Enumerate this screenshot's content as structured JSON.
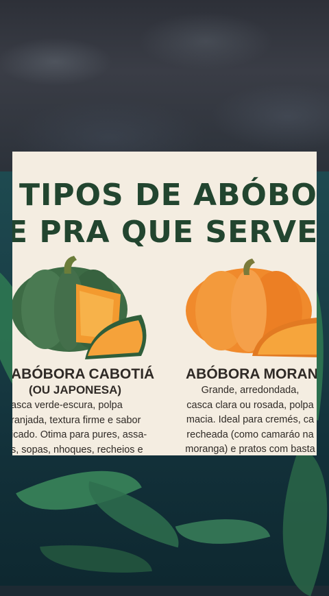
{
  "card": {
    "title_line1": "TIPOS DE ABÓBORA",
    "title_line2": "E PRA QUE SERVE"
  },
  "pumpkins": [
    {
      "name": "ABÓBORA CABOTIÁ",
      "subtitle": "(OU JAPONESA)",
      "description": [
        "asca verde-escura, polpa",
        "ranjada, textura firme e sabor",
        "icado. Otima para pures, assa-",
        "s, sopas, nhoques, recheios e"
      ],
      "icon": "green-pumpkin-illustration"
    },
    {
      "name": "ABÓBORA MORANG",
      "description": [
        "Grande, arredondada,",
        "casca clara ou rosada, polpa",
        "macia. Ideal para cremés, ca",
        "recheada (como camaráo na",
        "moranga) e pratos com basta"
      ],
      "icon": "orange-pumpkin-illustration"
    }
  ],
  "colors": {
    "title": "#22452f",
    "card_background": "#f4ede1",
    "text": "#2f2a26"
  }
}
